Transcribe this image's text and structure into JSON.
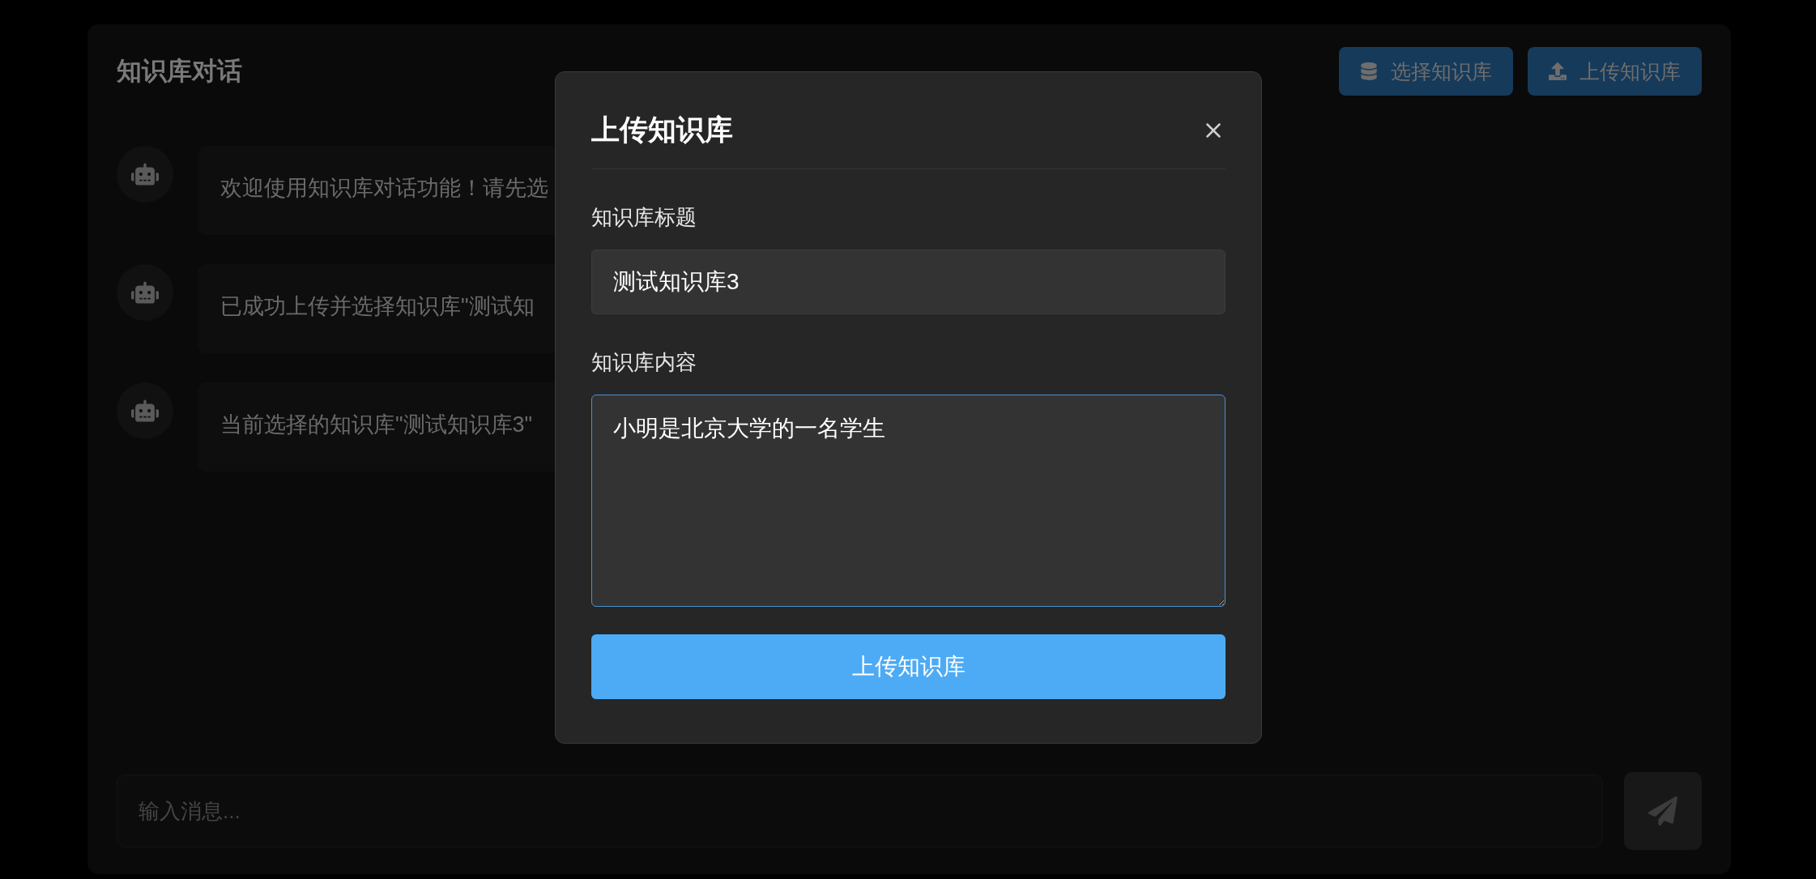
{
  "page": {
    "title": "知识库对话",
    "buttons": [
      {
        "kind": "select",
        "label": "选择知识库"
      },
      {
        "kind": "upload",
        "label": "上传知识库"
      }
    ]
  },
  "messages": [
    {
      "text": "欢迎使用知识库对话功能！请先选"
    },
    {
      "text": "已成功上传并选择知识库\"测试知"
    },
    {
      "text": "当前选择的知识库\"测试知识库3\""
    }
  ],
  "composer": {
    "placeholder": "输入消息..."
  },
  "modal": {
    "title": "上传知识库",
    "title_label": "知识库标题",
    "title_value": "测试知识库3",
    "content_label": "知识库内容",
    "content_value": "小明是北京大学的一名学生",
    "submit": "上传知识库"
  }
}
